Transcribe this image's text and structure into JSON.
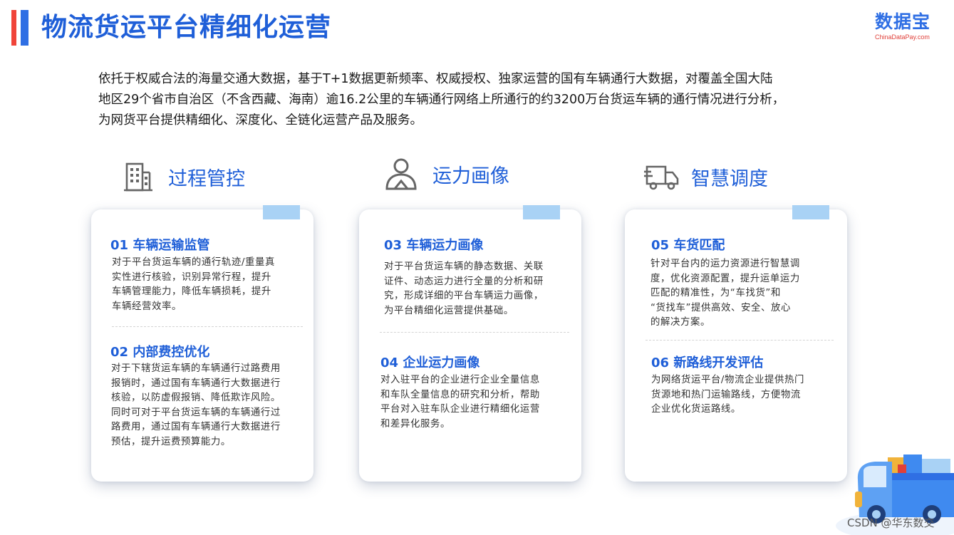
{
  "header": {
    "title": "物流货运平台精细化运营",
    "logo_main": "数据宝",
    "logo_sub": "ChinaDataPay.com"
  },
  "intro": {
    "lines": [
      "依托于权威合法的海量交通大数据，基于T+1数据更新频率、权威授权、独家运营的国有车辆通行大数据，对覆盖全国大陆",
      "地区29个省市自治区（不含西藏、海南）逾16.2公里的车辆通行网络上所通行的约3200万台货运车辆的通行情况进行分析，",
      "为网货平台提供精细化、深度化、全链化运营产品及服务。"
    ]
  },
  "sections": [
    {
      "label": "过程管控",
      "icon": "building-icon",
      "items": [
        {
          "title": "01  车辆运输监管",
          "lines": [
            "对于平台货运车辆的通行轨迹/重量真",
            "实性进行核验，识别异常行程，提升",
            "车辆管理能力，降低车辆损耗，提升",
            "车辆经营效率。"
          ]
        },
        {
          "title": "02  内部费控优化",
          "lines": [
            "对于下辖货运车辆的车辆通行过路费用",
            "报销时，通过国有车辆通行大数据进行",
            "核验，以防虚假报销、降低欺诈风险。",
            "同时可对于平台货运车辆的车辆通行过",
            "路费用，通过国有车辆通行大数据进行",
            "预估，提升运费预算能力。"
          ]
        }
      ]
    },
    {
      "label": "运力画像",
      "icon": "person-icon",
      "items": [
        {
          "title": "03  车辆运力画像",
          "lines": [
            "对于平台货运车辆的静态数据、关联",
            "证件、动态运力进行全量的分析和研",
            "究，形成详细的平台车辆运力画像，",
            "为平台精细化运营提供基础。"
          ]
        },
        {
          "title": "04  企业运力画像",
          "lines": [
            "对入驻平台的企业进行企业全量信息",
            "和车队全量信息的研究和分析，帮助",
            "平台对入驻车队企业进行精细化运营",
            "和差异化服务。"
          ]
        }
      ]
    },
    {
      "label": "智慧调度",
      "icon": "truck-icon",
      "items": [
        {
          "title": "05  车货匹配",
          "lines": [
            "针对平台内的运力资源进行智慧调",
            "度，优化资源配置，提升运单运力",
            "匹配的精准性，为“车找货”和",
            "“货找车”提供高效、安全、放心",
            "的解决方案。"
          ]
        },
        {
          "title": "06  新路线开发评估",
          "lines": [
            "为网络货运平台/物流企业提供热门",
            "货源地和热门运输路线，方便物流",
            "企业优化货运路线。"
          ]
        }
      ]
    }
  ],
  "footer": {
    "watermark": "CSDN @华东数交"
  },
  "colors": {
    "accent_blue": "#1f5fd8",
    "accent_red": "#f0443a",
    "tab_blue": "#a9d2f5"
  }
}
